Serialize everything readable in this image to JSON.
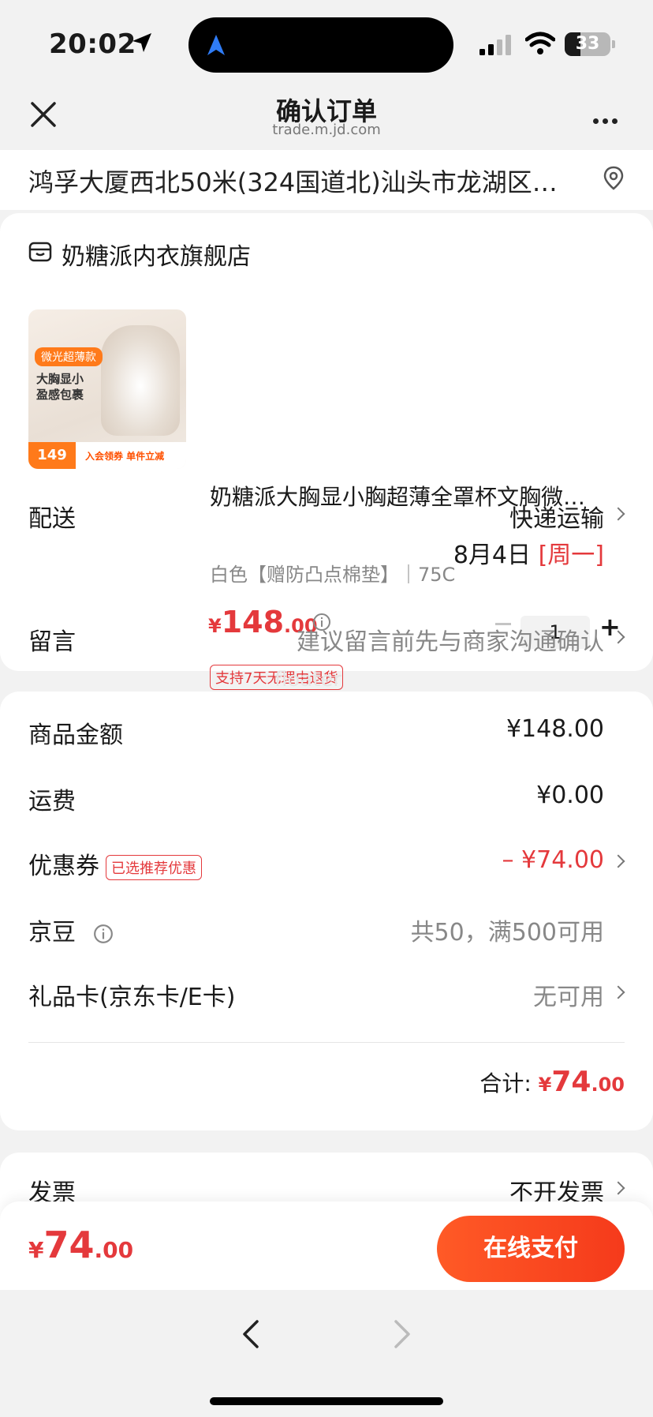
{
  "status_bar": {
    "time": "20:02",
    "battery": "33"
  },
  "header": {
    "title": "确认订单",
    "domain": "trade.m.jd.com"
  },
  "address": "鸿孚大厦西北50米(324国道北)汕头市龙湖区…",
  "store": {
    "name": "奶糖派内衣旗舰店"
  },
  "product": {
    "title": "奶糖派大胸显小胸超薄全罩杯文胸微…",
    "spec": "白色【赠防凸点棉垫】｜75C",
    "price_currency": "¥",
    "price_int": "148",
    "price_dec": ".00",
    "quantity": "1",
    "return_badge": "支持7天无理由退货",
    "thumb_tag": "微光超薄款",
    "thumb_line1": "大胸显小",
    "thumb_line2": "盈感包裹",
    "thumb_price": "149",
    "thumb_promo": "入会领券 单件立减"
  },
  "delivery": {
    "label": "配送",
    "method": "快递运输",
    "date": "8月4日",
    "weekday": "[周一]"
  },
  "message": {
    "label": "留言",
    "placeholder": "建议留言前先与商家沟通确认"
  },
  "watermark": "floater",
  "summary": {
    "goods_label": "商品金额",
    "goods_value": "¥148.00",
    "shipping_label": "运费",
    "shipping_value": "¥0.00",
    "coupon_label": "优惠券",
    "coupon_tag": "已选推荐优惠",
    "coupon_value": "– ¥74.00",
    "beans_label": "京豆",
    "beans_value": "共50，满500可用",
    "giftcard_label": "礼品卡(京东卡/E卡)",
    "giftcard_value": "无可用",
    "total_label": "合计:",
    "total_currency": "¥",
    "total_int": "74",
    "total_dec": ".00"
  },
  "invoice": {
    "label": "发票",
    "value": "不开发票"
  },
  "paybar": {
    "currency": "¥",
    "amount_int": "74",
    "amount_dec": ".00",
    "button": "在线支付"
  },
  "colors": {
    "accent": "#e4393c",
    "pay_button": "#f53a1b"
  }
}
